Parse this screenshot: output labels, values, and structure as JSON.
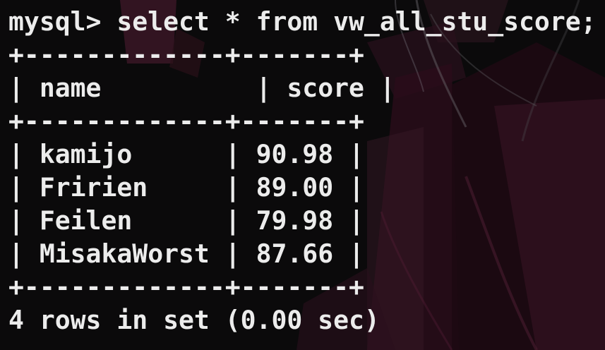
{
  "terminal": {
    "prompt": "mysql>",
    "command": "select * from vw_all_stu_score;",
    "border": "+-------------+-------+",
    "columns": [
      "name",
      "score"
    ],
    "rows": [
      {
        "name": "kamijo",
        "score": "90.98"
      },
      {
        "name": "Fririen",
        "score": "89.00"
      },
      {
        "name": "Feilen",
        "score": "79.98"
      },
      {
        "name": "MisakaWorst",
        "score": "87.66"
      }
    ],
    "footer": "4 rows in set (0.00 sec)"
  },
  "colors": {
    "text": "#ececec",
    "background": "#0b0a0b",
    "wallpaper_accent": "#5a1f35"
  }
}
